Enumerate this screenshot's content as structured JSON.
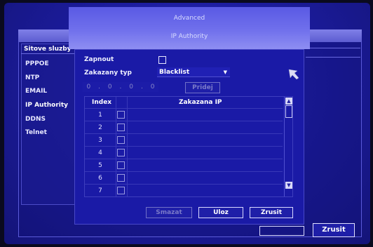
{
  "background_window": {
    "side_menu": {
      "header": "Sitove sluzby",
      "items": [
        {
          "label": "PPPOE"
        },
        {
          "label": "NTP"
        },
        {
          "label": "EMAIL"
        },
        {
          "label": "IP Authority"
        },
        {
          "label": "DDNS"
        },
        {
          "label": "Telnet"
        }
      ]
    },
    "cancel_label": "Zrusit"
  },
  "dialog": {
    "title": "Advanced",
    "subtitle": "IP Authority",
    "enable_label": "Zapnout",
    "enable_checked": false,
    "list_type_label": "Zakazany typ",
    "list_type_value": "Blacklist",
    "ip_octets": [
      "0",
      "0",
      "0",
      "0"
    ],
    "ip_separators": [
      ".",
      ".",
      "."
    ],
    "add_label": "Pridej",
    "table": {
      "headers": [
        "Index",
        "Zakazana IP"
      ],
      "rows": [
        {
          "index": "1",
          "ip": ""
        },
        {
          "index": "2",
          "ip": ""
        },
        {
          "index": "3",
          "ip": ""
        },
        {
          "index": "4",
          "ip": ""
        },
        {
          "index": "5",
          "ip": ""
        },
        {
          "index": "6",
          "ip": ""
        },
        {
          "index": "7",
          "ip": ""
        }
      ]
    },
    "delete_label": "Smazat",
    "save_label": "Uloz",
    "cancel_label": "Zrusit"
  },
  "colors": {
    "screen": "#1c1c9e",
    "titlebar": "#7070ec",
    "dialog": "#1a1aa6",
    "text": "#eef0ff",
    "disabled": "#7a7ac8"
  }
}
